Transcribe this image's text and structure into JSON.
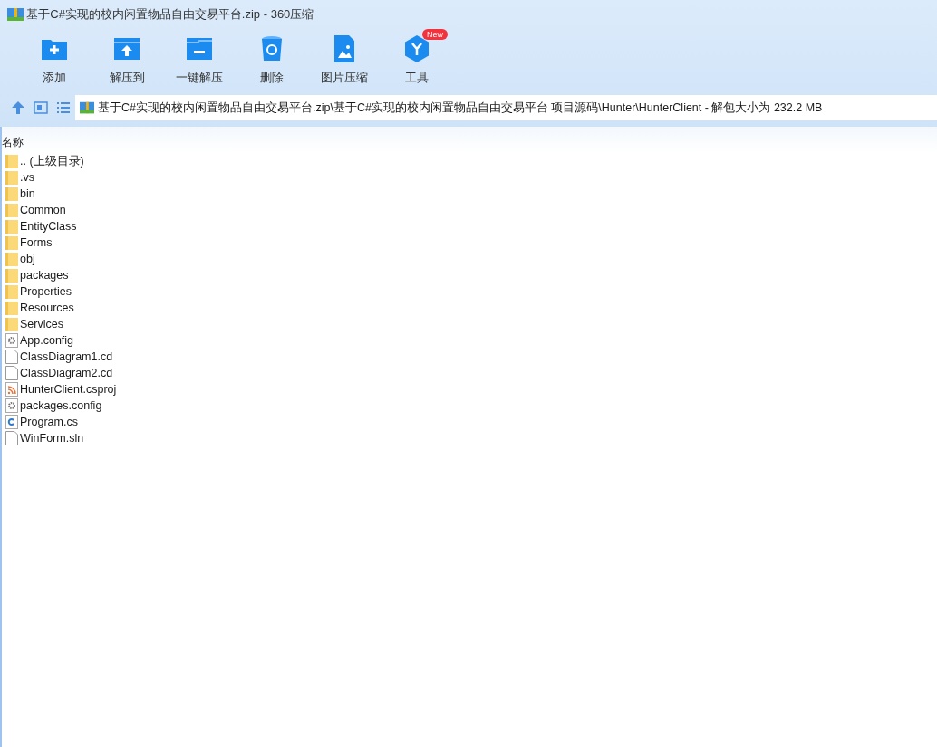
{
  "window": {
    "title": "基于C#实现的校内闲置物品自由交易平台.zip - 360压缩"
  },
  "toolbar": [
    {
      "kind": "add",
      "label": "添加"
    },
    {
      "kind": "extract",
      "label": "解压到"
    },
    {
      "kind": "oneclick",
      "label": "一键解压"
    },
    {
      "kind": "delete",
      "label": "删除"
    },
    {
      "kind": "image",
      "label": "图片压缩"
    },
    {
      "kind": "tools",
      "label": "工具",
      "badge": "New"
    }
  ],
  "address_bar": {
    "path": "基于C#实现的校内闲置物品自由交易平台.zip\\基于C#实现的校内闲置物品自由交易平台 项目源码\\Hunter\\HunterClient - 解包大小为 232.2 MB"
  },
  "file_list": {
    "columns": [
      "名称"
    ],
    "items": [
      {
        "kind": "folder",
        "name": ".. (上级目录)"
      },
      {
        "kind": "folder",
        "name": ".vs"
      },
      {
        "kind": "folder",
        "name": "bin"
      },
      {
        "kind": "folder",
        "name": "Common"
      },
      {
        "kind": "folder",
        "name": "EntityClass"
      },
      {
        "kind": "folder",
        "name": "Forms"
      },
      {
        "kind": "folder",
        "name": "obj"
      },
      {
        "kind": "folder",
        "name": "packages"
      },
      {
        "kind": "folder",
        "name": "Properties"
      },
      {
        "kind": "folder",
        "name": "Resources"
      },
      {
        "kind": "folder",
        "name": "Services"
      },
      {
        "kind": "config",
        "name": "App.config"
      },
      {
        "kind": "file",
        "name": "ClassDiagram1.cd"
      },
      {
        "kind": "file",
        "name": "ClassDiagram2.cd"
      },
      {
        "kind": "project",
        "name": "HunterClient.csproj"
      },
      {
        "kind": "config",
        "name": "packages.config"
      },
      {
        "kind": "csharp",
        "name": "Program.cs"
      },
      {
        "kind": "file",
        "name": "WinForm.sln"
      }
    ]
  }
}
